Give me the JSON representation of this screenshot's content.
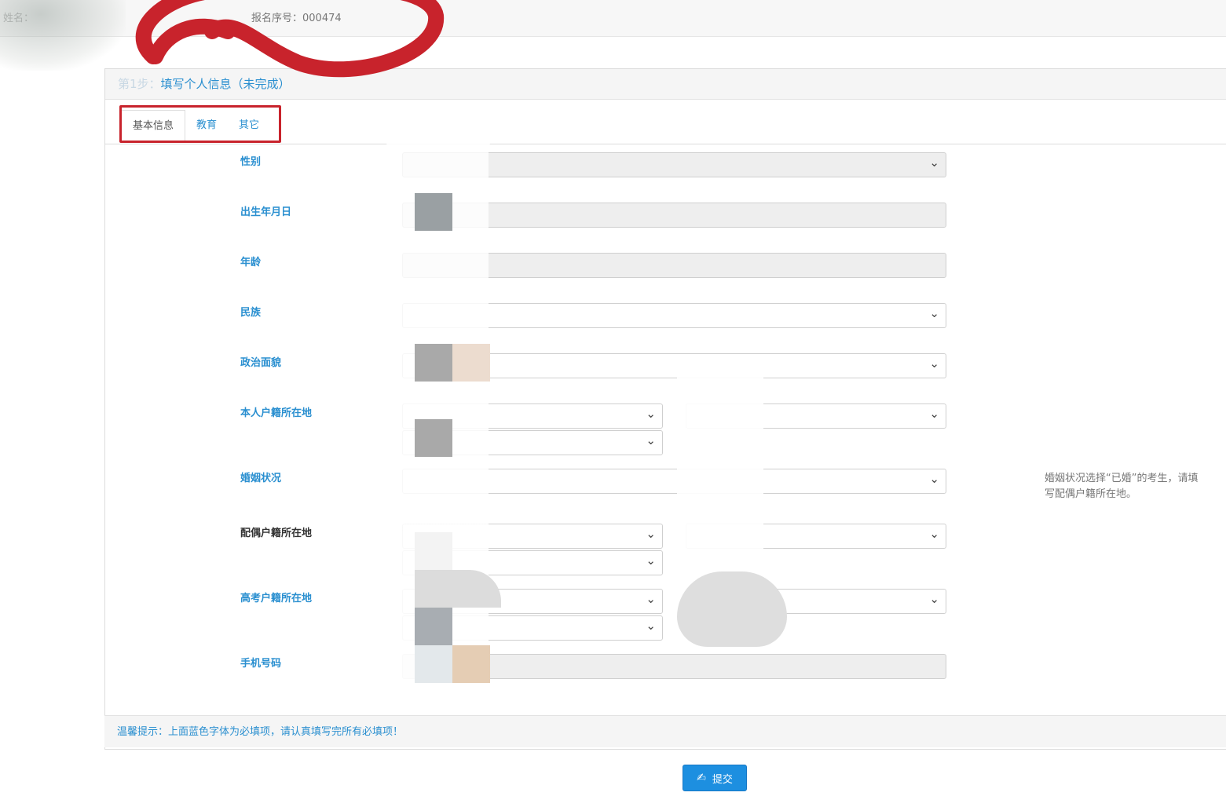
{
  "header": {
    "name_label": "姓名：",
    "serial": "报名序号：000474"
  },
  "panel": {
    "step_prefix": "第1步：",
    "title": "填写个人信息（未完成）"
  },
  "tabs": [
    {
      "label": "基本信息",
      "active": true
    },
    {
      "label": "教育",
      "active": false
    },
    {
      "label": "其它",
      "active": false
    }
  ],
  "form": {
    "gender": "性别",
    "birth_date": "出生年月日",
    "age": "年龄",
    "ethnicity": "民族",
    "political_status": "政治面貌",
    "household": "本人户籍所在地",
    "marital_status": "婚姻状况",
    "spouse_household": "配偶户籍所在地",
    "exam_household": "高考户籍所在地",
    "mobile": "手机号码"
  },
  "side_hint": "婚姻状况选择“已婚”的考生，请填写配偶户籍所在地。",
  "footer_tip": "温馨提示：上面蓝色字体为必填项，请认真填写完所有必填项！",
  "submit_label": "提交",
  "colors": {
    "accent": "#2a8fd0",
    "button": "#1d8fe0",
    "highlight_red": "#c8232c"
  }
}
